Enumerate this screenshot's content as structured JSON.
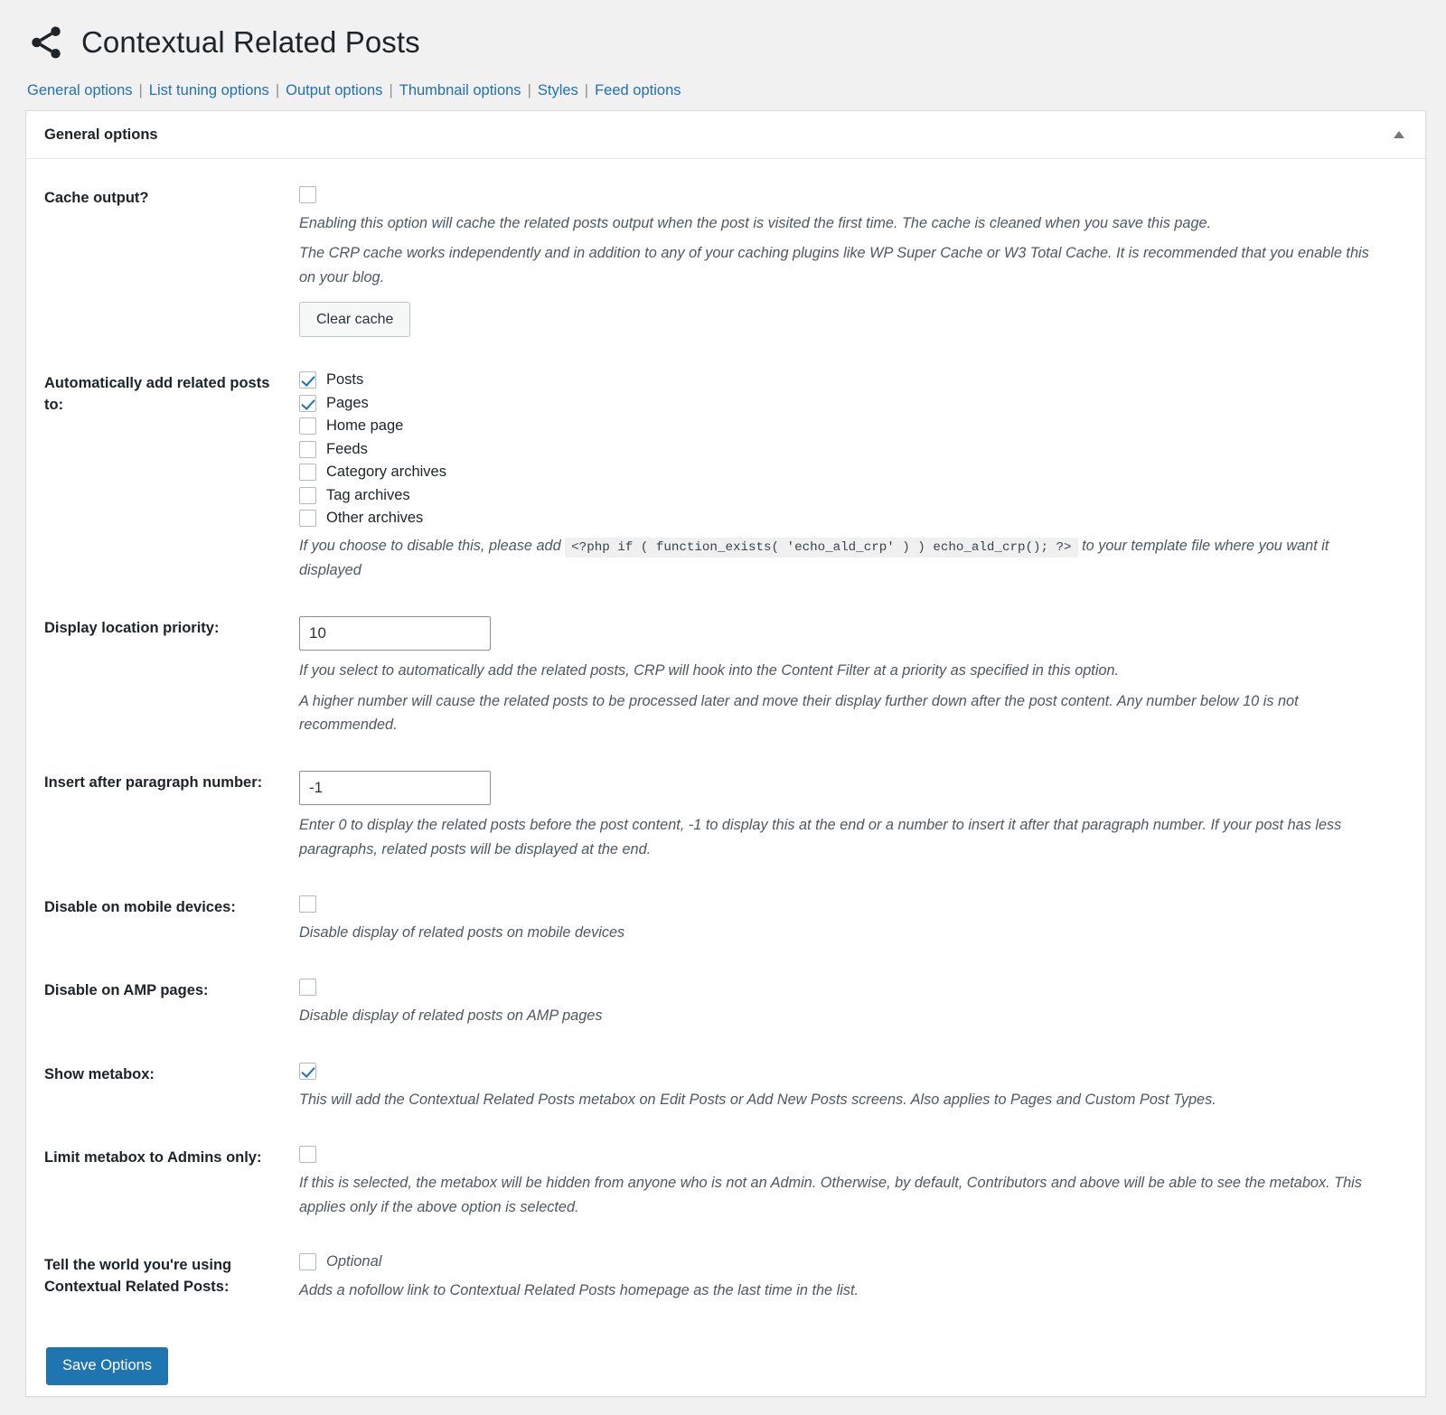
{
  "header": {
    "title": "Contextual Related Posts",
    "icon": "share-icon"
  },
  "nav": {
    "separator": "|",
    "items": [
      {
        "label": "General options"
      },
      {
        "label": "List tuning options"
      },
      {
        "label": "Output options"
      },
      {
        "label": "Thumbnail options"
      },
      {
        "label": "Styles"
      },
      {
        "label": "Feed options"
      }
    ]
  },
  "panel": {
    "title": "General options",
    "toggle_icon": "caret-up-icon"
  },
  "rows": {
    "cache_output": {
      "label": "Cache output?",
      "checked": false,
      "desc1": "Enabling this option will cache the related posts output when the post is visited the first time. The cache is cleaned when you save this page.",
      "desc2": "The CRP cache works independently and in addition to any of your caching plugins like WP Super Cache or W3 Total Cache. It is recommended that you enable this on your blog.",
      "clear_cache_label": "Clear cache"
    },
    "auto_add": {
      "label": "Automatically add related posts to:",
      "options": [
        {
          "label": "Posts",
          "checked": true
        },
        {
          "label": "Pages",
          "checked": true
        },
        {
          "label": "Home page",
          "checked": false
        },
        {
          "label": "Feeds",
          "checked": false
        },
        {
          "label": "Category archives",
          "checked": false
        },
        {
          "label": "Tag archives",
          "checked": false
        },
        {
          "label": "Other archives",
          "checked": false
        }
      ],
      "desc_before": "If you choose to disable this, please add",
      "code": "<?php if ( function_exists( 'echo_ald_crp' ) ) echo_ald_crp(); ?>",
      "desc_after": "to your template file where you want it displayed"
    },
    "display_priority": {
      "label": "Display location priority:",
      "value": "10",
      "desc1": "If you select to automatically add the related posts, CRP will hook into the Content Filter at a priority as specified in this option.",
      "desc2": "A higher number will cause the related posts to be processed later and move their display further down after the post content. Any number below 10 is not recommended."
    },
    "insert_after_paragraph": {
      "label": "Insert after paragraph number:",
      "value": "-1",
      "desc1": "Enter 0 to display the related posts before the post content, -1 to display this at the end or a number to insert it after that paragraph number. If your post has less paragraphs, related posts will be displayed at the end."
    },
    "disable_mobile": {
      "label": "Disable on mobile devices:",
      "checked": false,
      "desc1": "Disable display of related posts on mobile devices"
    },
    "disable_amp": {
      "label": "Disable on AMP pages:",
      "checked": false,
      "desc1": "Disable display of related posts on AMP pages"
    },
    "show_metabox": {
      "label": "Show metabox:",
      "checked": true,
      "desc1": "This will add the Contextual Related Posts metabox on Edit Posts or Add New Posts screens. Also applies to Pages and Custom Post Types."
    },
    "limit_metabox_admins": {
      "label": "Limit metabox to Admins only:",
      "checked": false,
      "desc1": "If this is selected, the metabox will be hidden from anyone who is not an Admin. Otherwise, by default, Contributors and above will be able to see the metabox. This applies only if the above option is selected."
    },
    "tell_the_world": {
      "label": "Tell the world you're using Contextual Related Posts:",
      "checked": false,
      "option_label": "Optional",
      "desc1": "Adds a nofollow link to Contextual Related Posts homepage as the last time in the list."
    }
  },
  "submit": {
    "save_label": "Save Options"
  },
  "colors": {
    "link": "#2271b1",
    "primary_button": "#1e75b0",
    "checkbox_check": "#2271b1"
  }
}
